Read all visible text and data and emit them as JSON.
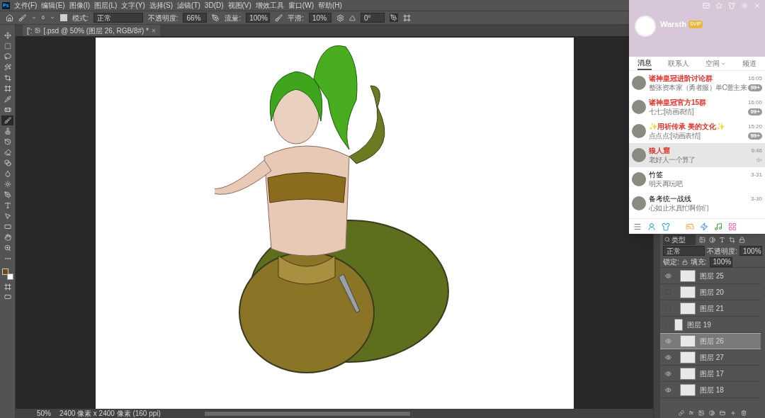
{
  "menu_bar": {
    "logo": "Ps",
    "items": [
      "文件(F)",
      "编辑(E)",
      "图像(I)",
      "图层(L)",
      "文字(Y)",
      "选择(S)",
      "滤镜(T)",
      "3D(D)",
      "视图(V)",
      "增效工具",
      "窗口(W)",
      "帮助(H)"
    ]
  },
  "options_bar": {
    "brush_size": "6",
    "mode_label": "模式:",
    "mode": "正常",
    "opacity_label": "不透明度:",
    "opacity": "66%",
    "flow_label": "流量:",
    "flow": "100%",
    "smoothing_label": "平滑:",
    "smoothing": "10%",
    "angle": "0°"
  },
  "document_tab": {
    "prefix": "[':",
    "title": "[.psd @ 50% (图层 26, RGB/8#) *",
    "close": "×"
  },
  "tools": [
    {
      "kind": "move",
      "selected": false
    },
    {
      "kind": "marquee",
      "selected": false
    },
    {
      "kind": "lasso",
      "selected": false
    },
    {
      "kind": "wand",
      "selected": false
    },
    {
      "kind": "crop",
      "selected": false
    },
    {
      "kind": "frame",
      "selected": false
    },
    {
      "kind": "eyedropper",
      "selected": false
    },
    {
      "kind": "healing",
      "selected": false
    },
    {
      "kind": "brush",
      "selected": true
    },
    {
      "kind": "stamp",
      "selected": false
    },
    {
      "kind": "history",
      "selected": false
    },
    {
      "kind": "eraser",
      "selected": false
    },
    {
      "kind": "gradient",
      "selected": false
    },
    {
      "kind": "blur",
      "selected": false
    },
    {
      "kind": "dodge",
      "selected": false
    },
    {
      "kind": "pen",
      "selected": false
    },
    {
      "kind": "type",
      "selected": false
    },
    {
      "kind": "select",
      "selected": false
    },
    {
      "kind": "rectangle",
      "selected": false
    },
    {
      "kind": "hand",
      "selected": false
    },
    {
      "kind": "zoom",
      "selected": false
    },
    {
      "kind": "more",
      "selected": false
    }
  ],
  "status_bar": {
    "zoom": "50%",
    "info": "2400 像素 x 2400 像素 (160 ppi)"
  },
  "chat_window": {
    "user_name": "Warsth",
    "badge": "SVIP",
    "tabs": [
      {
        "label": "消息",
        "selected": true,
        "dropdown": false
      },
      {
        "label": "联系人",
        "selected": false,
        "dropdown": false
      },
      {
        "label": "空间",
        "selected": false,
        "dropdown": true
      },
      {
        "label": "频道",
        "selected": false,
        "dropdown": false
      }
    ],
    "conversations": [
      {
        "name": "诸神皇冠进阶讨论群",
        "preview": "整张资本家（勇者服）单C蕾主来",
        "time": "16:05",
        "badge": "99+",
        "vip": true,
        "selected": false,
        "muted": false
      },
      {
        "name": "诸神皇冠官方15群",
        "preview": "七七:[动画表情]",
        "time": "16:00",
        "badge": "99+",
        "vip": true,
        "selected": false,
        "muted": false
      },
      {
        "name": "✨用祈传承 美的文化✨",
        "preview": "点点点:[动画表情]",
        "time": "15:20",
        "badge": "99+",
        "vip": true,
        "selected": false,
        "muted": false
      },
      {
        "name": "狼人窟",
        "preview": "老好人一个算了",
        "time": "9:46",
        "vip": true,
        "selected": true,
        "muted": true
      },
      {
        "name": "竹签",
        "preview": "明天再玩吧",
        "time": "3-31",
        "vip": false,
        "selected": false,
        "muted": false
      },
      {
        "name": "备考统一战线",
        "preview": "心如止水真忙啊你们",
        "time": "3-30",
        "vip": false,
        "selected": false,
        "muted": false
      }
    ]
  },
  "layers_panel": {
    "filter": "类型",
    "blend_mode": "正常",
    "opacity_label": "不透明度:",
    "opacity": "100%",
    "lock_label": "锁定:",
    "fill_label": "填充:",
    "fill": "100%",
    "fx_label": "fx",
    "layers": [
      {
        "name": "图层 25",
        "visible": true,
        "selected": false,
        "clipped": false
      },
      {
        "name": "图层 20",
        "visible": false,
        "selected": false,
        "clipped": false
      },
      {
        "name": "图层 21",
        "visible": false,
        "selected": false,
        "clipped": false
      },
      {
        "name": "图层 19",
        "visible": false,
        "selected": false,
        "clipped": true
      },
      {
        "name": "图层 26",
        "visible": true,
        "selected": true,
        "clipped": false
      },
      {
        "name": "图层 27",
        "visible": true,
        "selected": false,
        "clipped": false
      },
      {
        "name": "图层 17",
        "visible": true,
        "selected": false,
        "clipped": false
      },
      {
        "name": "图层 18",
        "visible": true,
        "selected": false,
        "clipped": false
      }
    ]
  }
}
